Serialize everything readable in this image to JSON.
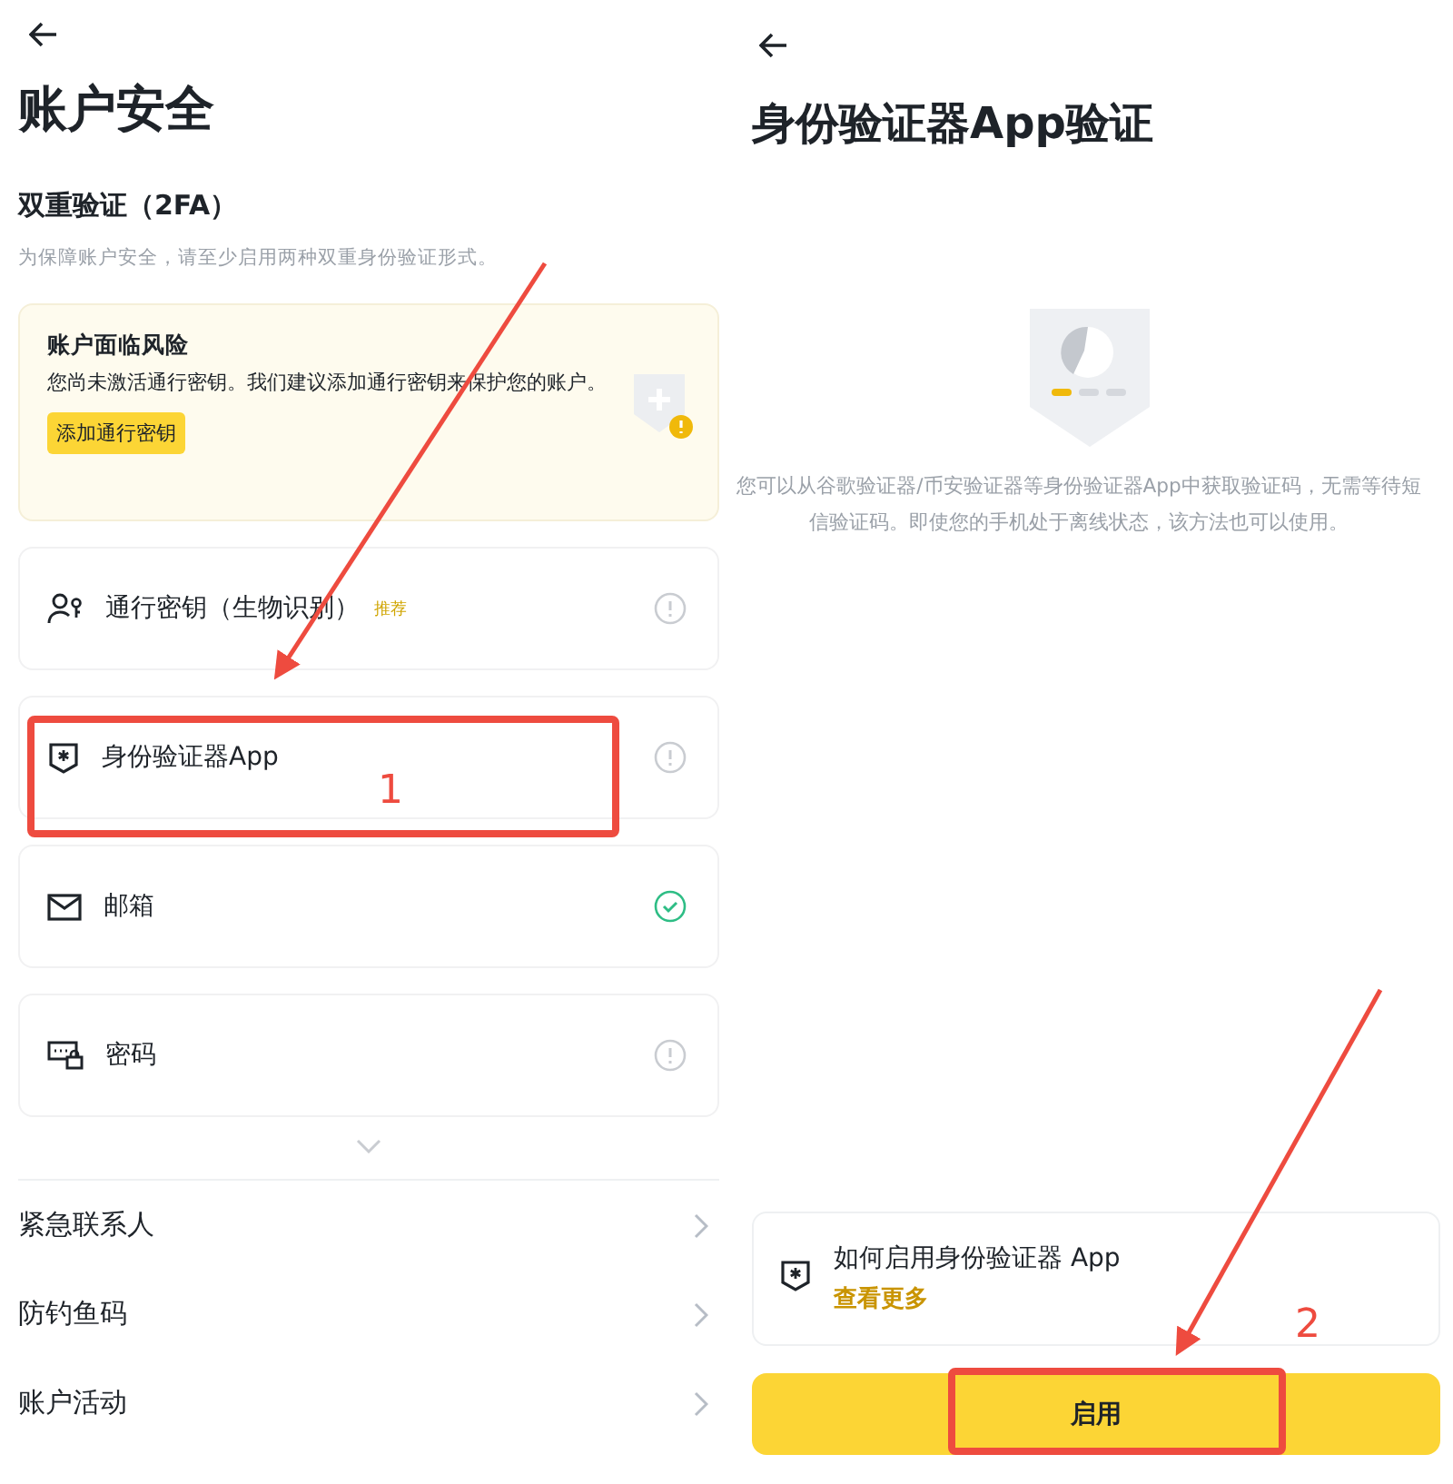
{
  "security_page": {
    "title": "账户安全",
    "section_title": "双重验证（2FA）",
    "section_hint": "为保障账户安全，请至少启用两种双重身份验证形式。",
    "warning": {
      "title": "账户面临风险",
      "text": "您尚未激活通行密钥。我们建议添加通行密钥来保护您的账户。",
      "button": "添加通行密钥"
    },
    "methods": [
      {
        "kind": "passkey",
        "label": "通行密钥（生物识别）",
        "badge": "推荐",
        "enabled": false
      },
      {
        "kind": "authenticator",
        "label": "身份验证器App",
        "enabled": false
      },
      {
        "kind": "email",
        "label": "邮箱",
        "enabled": true
      },
      {
        "kind": "password",
        "label": "密码",
        "enabled": false
      }
    ],
    "links": [
      "紧急联系人",
      "防钓鱼码",
      "账户活动"
    ]
  },
  "authenticator_page": {
    "title": "身份验证器App验证",
    "description": "您可以从谷歌验证器/币安验证器等身份验证器App中获取验证码，无需等待短信验证码。即使您的手机处于离线状态，该方法也可以使用。",
    "help": {
      "title": "如何启用身份验证器 App",
      "link": "查看更多"
    },
    "button": "启用"
  },
  "annotations": [
    {
      "label": "1"
    },
    {
      "label": "2"
    }
  ]
}
